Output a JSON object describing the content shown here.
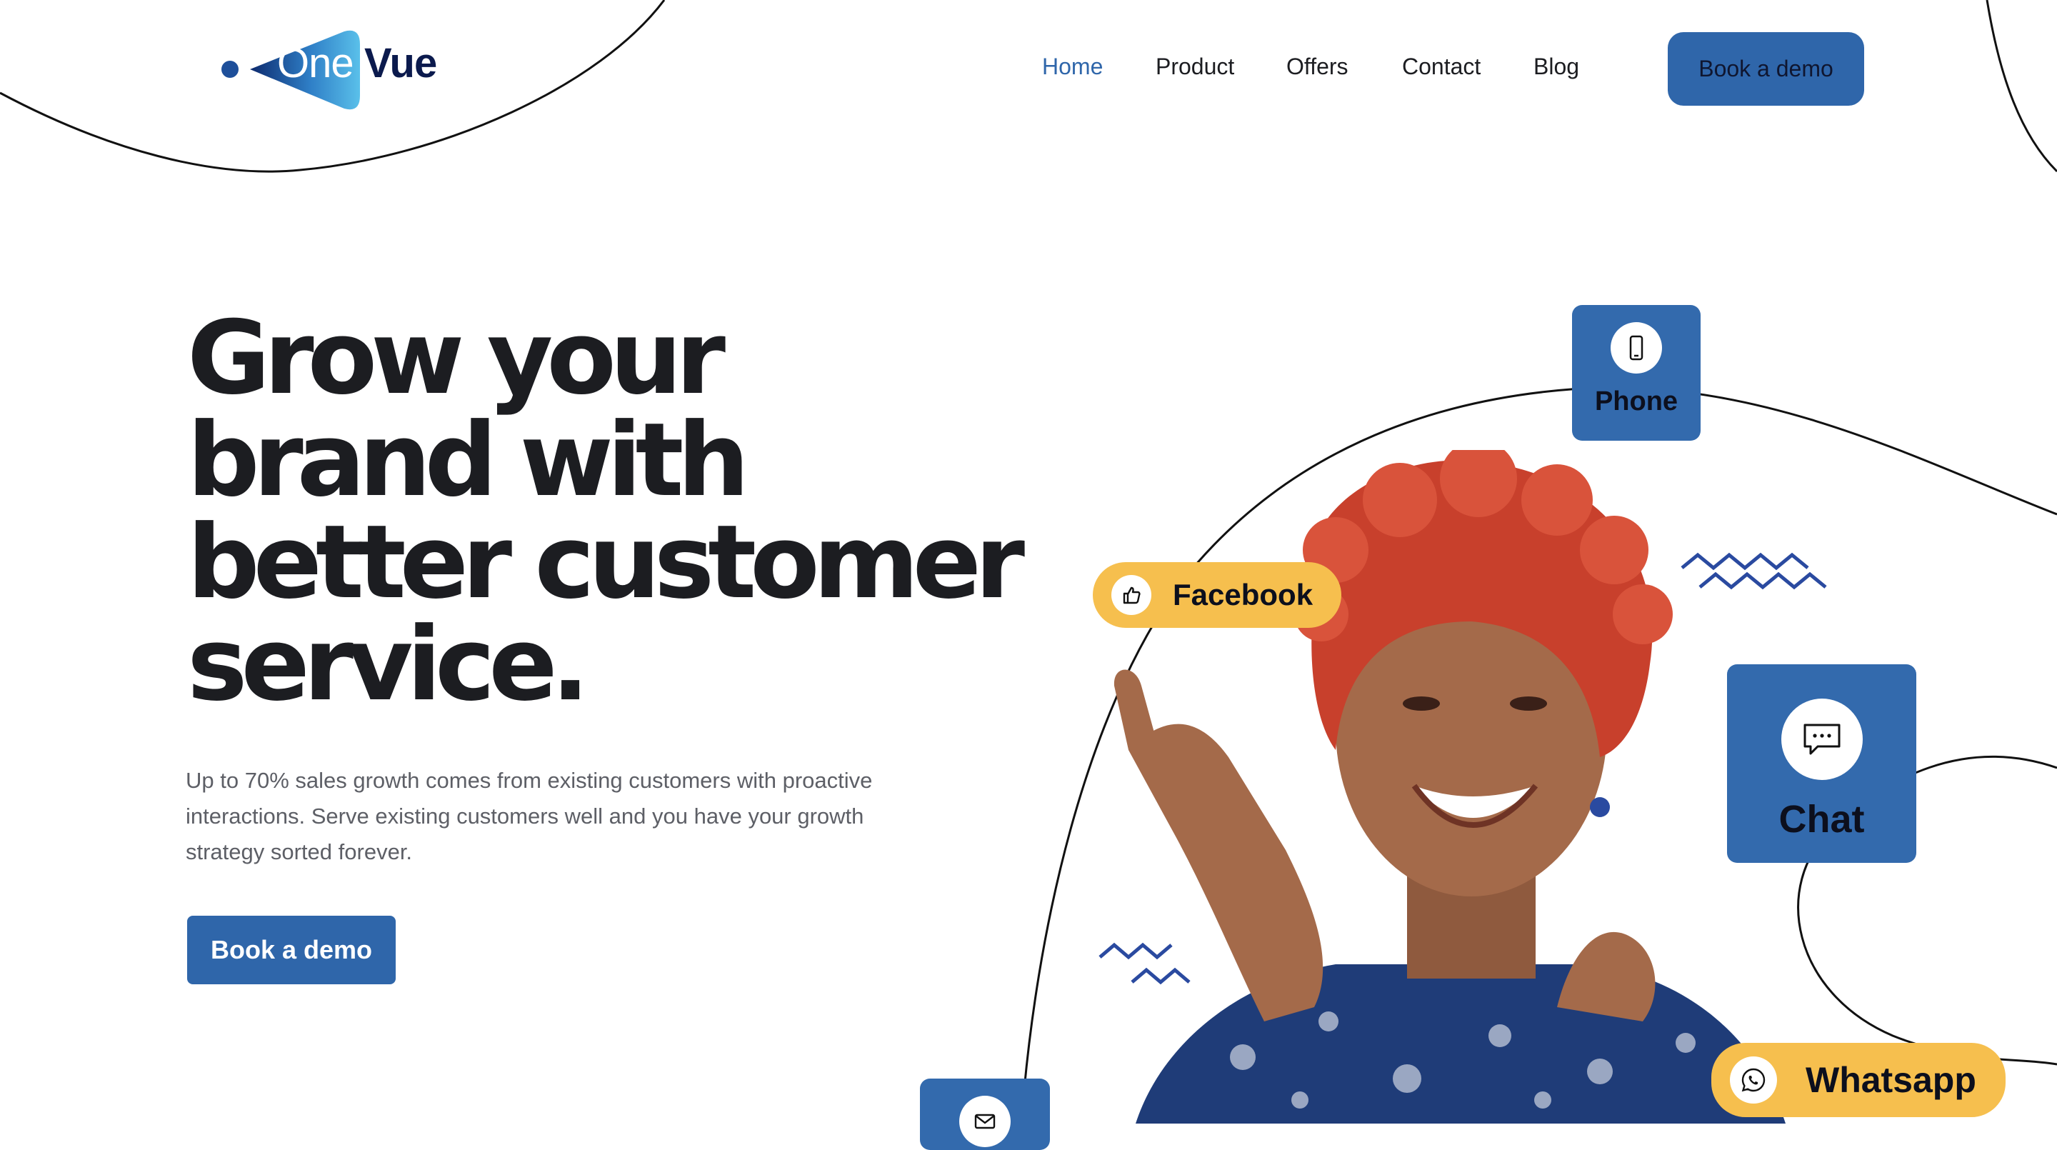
{
  "logo": {
    "part1": "One",
    "part2": "Vue"
  },
  "nav": {
    "items": [
      {
        "label": "Home",
        "active": true
      },
      {
        "label": "Product",
        "active": false
      },
      {
        "label": "Offers",
        "active": false
      },
      {
        "label": "Contact",
        "active": false
      },
      {
        "label": "Blog",
        "active": false
      }
    ],
    "cta_label": "Book a demo"
  },
  "hero": {
    "title_lines": [
      "Grow your",
      "brand with",
      "better customer",
      "service."
    ],
    "subtitle": "Up to 70% sales growth comes from existing customers with proactive interactions. Serve existing customers well and you have your growth strategy sorted forever.",
    "cta_label": "Book a demo"
  },
  "channels": {
    "phone": {
      "label": "Phone",
      "icon": "phone-icon"
    },
    "facebook": {
      "label": "Facebook",
      "icon": "thumbs-up-icon"
    },
    "chat": {
      "label": "Chat",
      "icon": "chat-bubble-icon"
    },
    "whatsapp": {
      "label": "Whatsapp",
      "icon": "whatsapp-icon"
    },
    "email": {
      "icon": "mail-icon"
    }
  },
  "colors": {
    "brand_blue": "#2f66aa",
    "card_blue": "#336aad",
    "pill_yellow": "#f6bf4e",
    "text_dark": "#1c1d21",
    "text_muted": "#5d5f66",
    "logo_navy": "#0b1a4d"
  }
}
